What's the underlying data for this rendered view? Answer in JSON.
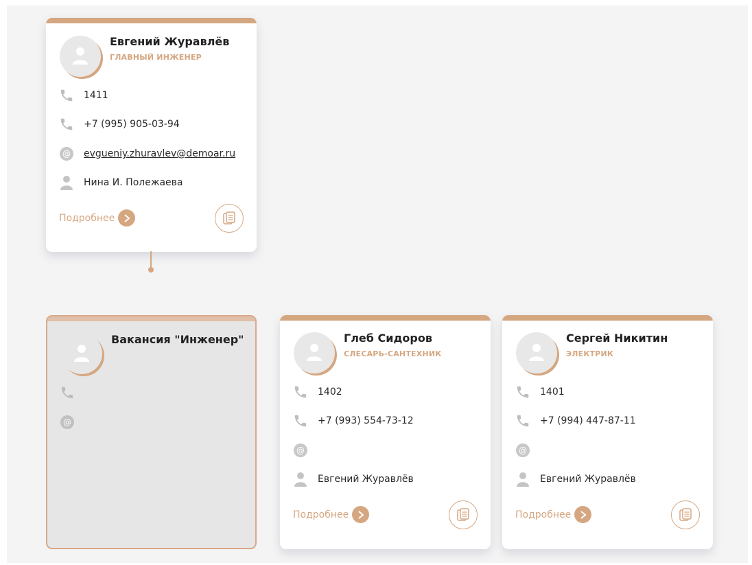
{
  "colors": {
    "accent": "#d5a781",
    "icon_gray": "#bdbdbd",
    "background": "#f4f4f4"
  },
  "cards": [
    {
      "name": "Евгений Журавлёв",
      "role": "ГЛАВНЫЙ ИНЖЕНЕР",
      "ext": "1411",
      "phone": "+7 (995) 905-03-94",
      "email": "evgueniy.zhuravlev@demoar.ru",
      "manager": "Нина И. Полежаева",
      "more_label": "Подробнее"
    },
    {
      "name": "Вакансия \"Инженер\""
    },
    {
      "name": "Глеб Сидоров",
      "role": "СЛЕСАРЬ-САНТЕХНИК",
      "ext": "1402",
      "phone": "+7 (993) 554-73-12",
      "email": "",
      "manager": "Евгений Журавлёв",
      "more_label": "Подробнее"
    },
    {
      "name": "Сергей Никитин",
      "role": "ЭЛЕКТРИК",
      "ext": "1401",
      "phone": "+7 (994) 447-87-11",
      "email": "",
      "manager": "Евгений Журавлёв",
      "more_label": "Подробнее"
    }
  ]
}
